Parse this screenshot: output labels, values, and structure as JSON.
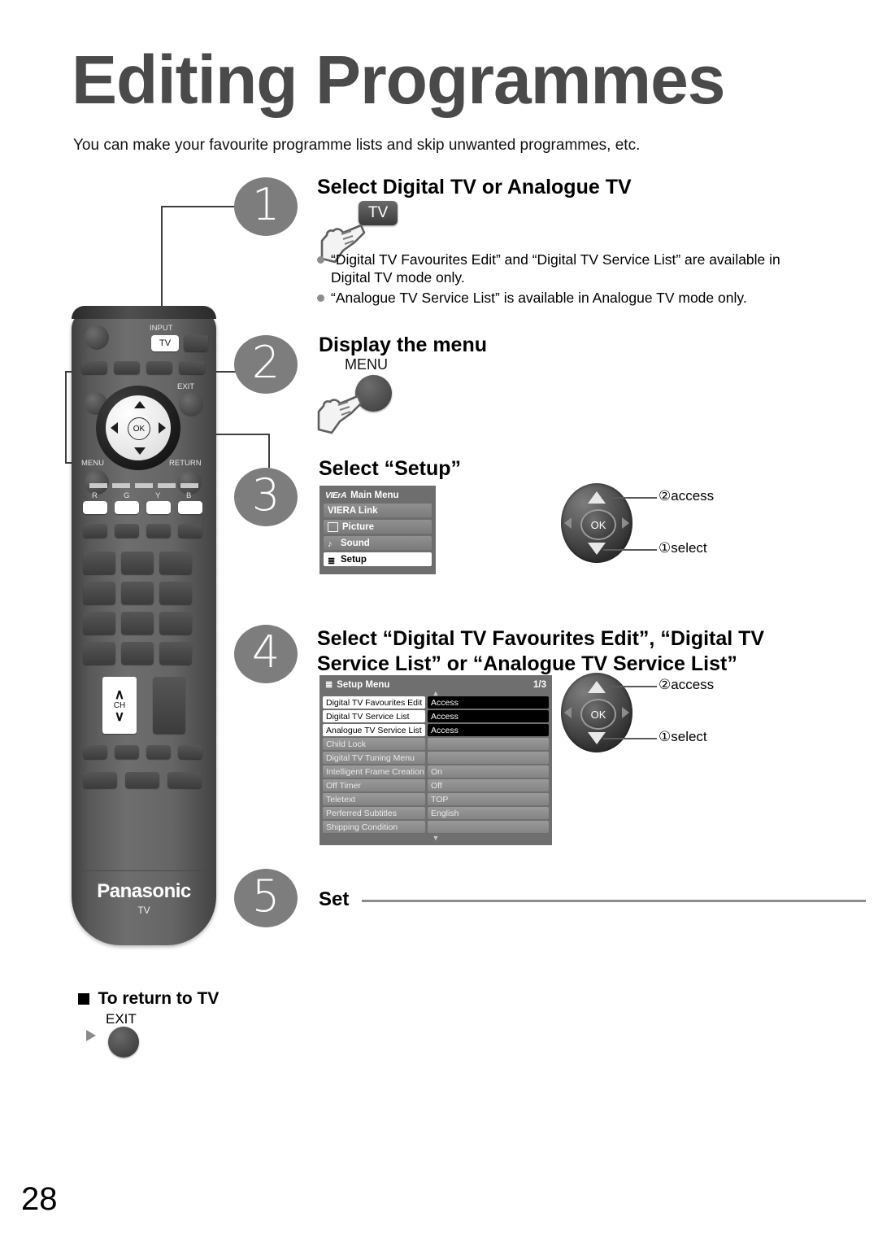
{
  "page": {
    "title": "Editing Programmes",
    "intro": "You can make your favourite programme lists and skip unwanted programmes, etc.",
    "page_number": "28"
  },
  "steps": [
    {
      "number": "1",
      "heading": "Select Digital TV or Analogue TV",
      "key_label": "TV",
      "notes": [
        "“Digital TV Favourites Edit” and “Digital TV Service List” are available in Digital TV mode only.",
        "“Analogue TV Service List” is available in Analogue TV mode only."
      ]
    },
    {
      "number": "2",
      "heading": "Display the menu",
      "key_label": "MENU"
    },
    {
      "number": "3",
      "heading": "Select “Setup”",
      "callouts": {
        "access": "②access",
        "select": "①select",
        "ok": "OK"
      }
    },
    {
      "number": "4",
      "heading": "Select “Digital TV Favourites Edit”, “Digital TV Service List” or “Analogue TV Service List”",
      "callouts": {
        "access": "②access",
        "select": "①select",
        "ok": "OK"
      }
    },
    {
      "number": "5",
      "heading": "Set"
    }
  ],
  "viera_menu": {
    "logo": "VIErA",
    "title": "Main Menu",
    "items": [
      {
        "label": "VIERA Link",
        "icon": "",
        "selected": false
      },
      {
        "label": "Picture",
        "icon": "picture-icon",
        "selected": false
      },
      {
        "label": "Sound",
        "icon": "sound-icon",
        "selected": false
      },
      {
        "label": "Setup",
        "icon": "setup-list-icon",
        "selected": true
      }
    ]
  },
  "setup_menu": {
    "title": "Setup Menu",
    "page_indicator": "1/3",
    "rows": [
      {
        "name": "Digital TV Favourites Edit",
        "value": "Access",
        "highlight": true,
        "access": true
      },
      {
        "name": "Digital TV Service List",
        "value": "Access",
        "highlight": true,
        "access": true
      },
      {
        "name": "Analogue TV Service List",
        "value": "Access",
        "highlight": true,
        "access": true
      },
      {
        "name": "Child Lock",
        "value": "",
        "highlight": false,
        "access": false
      },
      {
        "name": "Digital TV Tuning Menu",
        "value": "",
        "highlight": false,
        "access": false
      },
      {
        "name": "Intelligent Frame Creation",
        "value": "On",
        "highlight": false,
        "access": false
      },
      {
        "name": "Off Timer",
        "value": "Off",
        "highlight": false,
        "access": false
      },
      {
        "name": "Teletext",
        "value": "TOP",
        "highlight": false,
        "access": false
      },
      {
        "name": "Perferred Subtitles",
        "value": "English",
        "highlight": false,
        "access": false
      },
      {
        "name": "Shipping Condition",
        "value": "",
        "highlight": false,
        "access": false
      }
    ]
  },
  "remote": {
    "brand": "Panasonic",
    "brand_sub": "TV",
    "labels": {
      "input": "INPUT",
      "tv": "TV",
      "exit": "EXIT",
      "menu": "MENU",
      "return": "RETURN",
      "ok": "OK",
      "ch": "CH",
      "color_r": "R",
      "color_g": "G",
      "color_y": "Y",
      "color_b": "B"
    }
  },
  "footer": {
    "return_heading": "To return to TV",
    "exit_label": "EXIT"
  }
}
